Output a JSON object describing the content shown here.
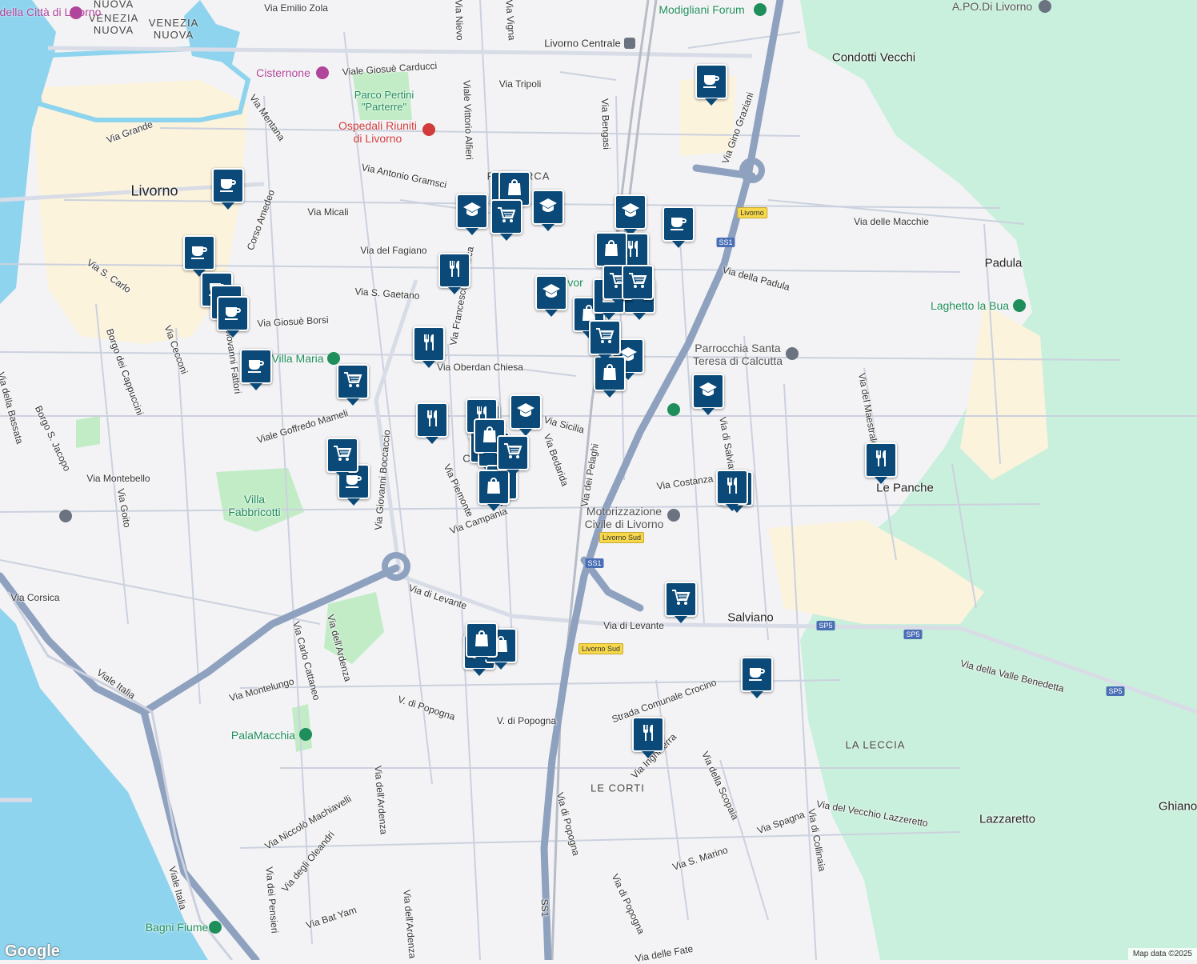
{
  "colors": {
    "land": "#f3f3f5",
    "water": "#8fd4ee",
    "forest": "#c9f0dc",
    "park": "#c2ecc6",
    "urban_highlight": "#fcf3dc",
    "highway": "#8ea1bf",
    "pin": "#0b4a78"
  },
  "streets": [
    "Via Emilio Zola",
    "Via Nievo",
    "Via Vigna",
    "Livorno Centrale",
    "Viale Giosuè Carducci",
    "Via Tripoli",
    "Via Mentana",
    "Via Grande",
    "Viale Vittorio Alfieri",
    "Via Bengasi",
    "Via Antonio Gramsci",
    "Via Micali",
    "Corso Amedeo",
    "Via del Fagiano",
    "Via S. Carlo",
    "Via S. Gaetano",
    "Via Francesco Petrarca",
    "Via Giosuè Borsi",
    "Borgo dei Cappuccini",
    "Via Cecconi",
    "Via Giovanni Fattori",
    "Via della Bassata",
    "Borgo S. Jacopo",
    "Viale Goffredo Mameli",
    "Via Oberdan Chiesa",
    "Via Montebello",
    "Via Goito",
    "Via Sicilia",
    "Via Bedarida",
    "Via dei Pelaghi",
    "Via Piemonte",
    "Via Campania",
    "Via Costanza",
    "Via di Salviano",
    "Via Giovanni Boccaccio",
    "Via Corsica",
    "Via di Levante",
    "Via di Levante",
    "Viale Italia",
    "Via Carlo Cattaneo",
    "Via dell'Ardenza",
    "Via Montelungo",
    "V. di Popogna",
    "V. di Popogna",
    "Strada Comunale Crocino",
    "Via Inghilterra",
    "Via della Scopaia",
    "Via Spagna",
    "Via del Vecchio Lazzeretto",
    "Via di Collinaia",
    "Via S. Marino",
    "Via di Popogna",
    "Via Niccolò Machiavelli",
    "Via degli Oleandri",
    "Via dei Pensieri",
    "Via Bat Yam",
    "Viale Italia",
    "Via dell'Ardenza",
    "Via di Popogna",
    "SS1",
    "Via delle Macchie",
    "Via della Padula",
    "Via Gino Graziani",
    "Via del Maestrale",
    "Via della Valle Benedetta",
    "Via dell'Ardenza",
    "Via delle Fate"
  ],
  "areas": [
    "Livorno",
    "Condotti Vecchi",
    "Padula",
    "Le Panche",
    "Salviano",
    "Lazzaretto",
    "Ghiano",
    "Villa Fabbricotti",
    "Parco Pertini \"Parterre\""
  ],
  "districts": [
    "VENEZIA NUOVA",
    "VENEZIA NUOVA",
    "NUOVA",
    "LE CORTI",
    "LA LECCIA",
    "CO",
    "PETRARCA"
  ],
  "pois": [
    {
      "name": "Museo della Città di Livorno",
      "kind": "museum"
    },
    {
      "name": "Cisternone",
      "kind": "museum"
    },
    {
      "name": "Ospedali Riuniti di Livorno",
      "kind": "hospital"
    },
    {
      "name": "Villa Maria",
      "kind": "park"
    },
    {
      "name": "Modigliani Forum",
      "kind": "park"
    },
    {
      "name": "A.PO.Di Livorno",
      "kind": "gray"
    },
    {
      "name": "Laghetto la Bua",
      "kind": "park"
    },
    {
      "name": "Parrocchia Santa Teresa di Calcutta",
      "kind": "church"
    },
    {
      "name": "Motorizzazione Civile di Livorno",
      "kind": "gray"
    },
    {
      "name": "PalaMacchia",
      "kind": "park"
    },
    {
      "name": "Bagni Fiume",
      "kind": "park"
    },
    {
      "name": "Fi  e Livor",
      "kind": "park"
    }
  ],
  "shields": [
    {
      "label": "SS1",
      "style": "blue"
    },
    {
      "label": "SS1",
      "style": "blue"
    },
    {
      "label": "SP5",
      "style": "blue"
    },
    {
      "label": "SP5",
      "style": "blue"
    },
    {
      "label": "SP5",
      "style": "blue"
    },
    {
      "label": "Livorno",
      "style": "yellow"
    },
    {
      "label": "Livorno Sud",
      "style": "yellow"
    },
    {
      "label": "Livorno Sud",
      "style": "yellow"
    }
  ],
  "markers": [
    "cafe",
    "cafe",
    "cafe",
    "cafe",
    "cafe",
    "cafe",
    "cafe",
    "cafe",
    "cafe",
    "cafe",
    "school",
    "school",
    "school",
    "school",
    "school",
    "school",
    "school",
    "school",
    "school",
    "restaurant",
    "restaurant",
    "restaurant",
    "restaurant",
    "restaurant",
    "restaurant",
    "restaurant",
    "restaurant",
    "restaurant",
    "restaurant",
    "restaurant",
    "shopping",
    "shopping",
    "shopping",
    "shopping",
    "shopping",
    "shopping",
    "shopping",
    "shopping",
    "shopping",
    "shopping",
    "shopping",
    "shopping",
    "grocery",
    "grocery",
    "grocery",
    "grocery",
    "grocery",
    "grocery",
    "grocery",
    "grocery"
  ],
  "attribution": "Map data ©2025",
  "logo": "Google"
}
